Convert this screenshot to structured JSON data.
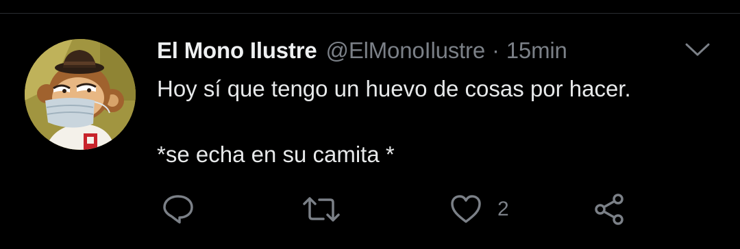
{
  "tweet": {
    "author_name": "El Mono Ilustre",
    "handle": "@ElMonoIlustre",
    "separator": "·",
    "time": "15min",
    "text_line1": "Hoy sí que tengo un huevo de cosas por hacer.",
    "text_line2": "*se echa en su camita *",
    "avatar_icon": "monkey-avatar-icon",
    "menu_icon": "chevron-down-icon"
  },
  "actions": {
    "reply_icon": "reply-icon",
    "retweet_icon": "retweet-icon",
    "like_icon": "heart-icon",
    "like_count": "2",
    "share_icon": "share-icon"
  },
  "colors": {
    "background": "#000000",
    "text": "#e7e9ea",
    "secondary": "#7b8087",
    "divider": "#2a2d31"
  }
}
